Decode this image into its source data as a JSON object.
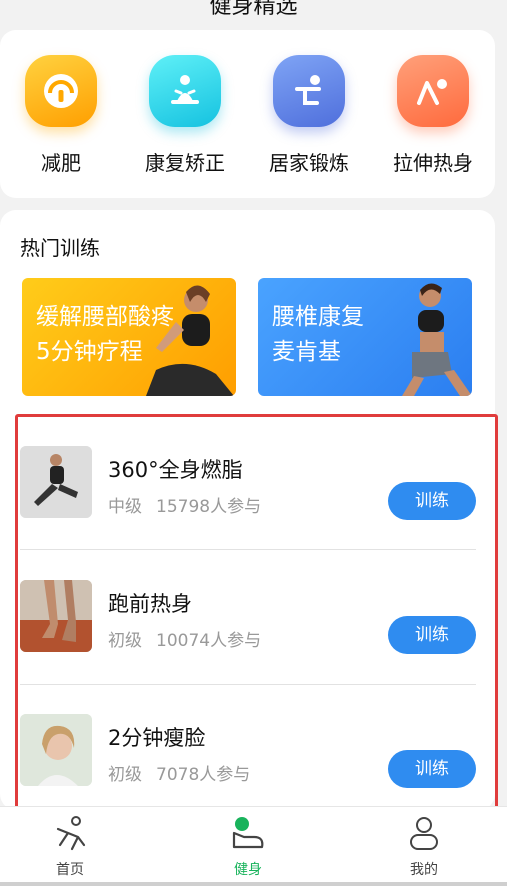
{
  "header": {
    "title": "健身精选"
  },
  "categories": [
    {
      "label": "减肥",
      "icon": "speedometer-icon",
      "color": "#ffb300"
    },
    {
      "label": "康复矫正",
      "icon": "meditation-icon",
      "color": "#29d3e6"
    },
    {
      "label": "居家锻炼",
      "icon": "home-exercise-icon",
      "color": "#5b7be6"
    },
    {
      "label": "拉伸热身",
      "icon": "stretch-icon",
      "color": "#ff7a4d"
    }
  ],
  "hot": {
    "title": "热门训练",
    "banners": [
      {
        "line1": "缓解腰部酸疼",
        "line2": "5分钟疗程",
        "color": "#ffb400"
      },
      {
        "line1": "腰椎康复",
        "line2": "麦肯基",
        "color": "#3b8ff2"
      }
    ]
  },
  "trainings": [
    {
      "name": "360°全身燃脂",
      "level": "中级",
      "participants": "15798人参与",
      "button": "训练"
    },
    {
      "name": "跑前热身",
      "level": "初级",
      "participants": "10074人参与",
      "button": "训练"
    },
    {
      "name": "2分钟瘦脸",
      "level": "初级",
      "participants": "7078人参与",
      "button": "训练"
    }
  ],
  "tabs": [
    {
      "label": "首页",
      "icon": "runner-icon"
    },
    {
      "label": "健身",
      "icon": "fitness-icon",
      "active": true
    },
    {
      "label": "我的",
      "icon": "profile-icon"
    }
  ],
  "colors": {
    "accent": "#2f8cf0",
    "active_tab": "#19b35c",
    "highlight_border": "#e03c3c"
  }
}
